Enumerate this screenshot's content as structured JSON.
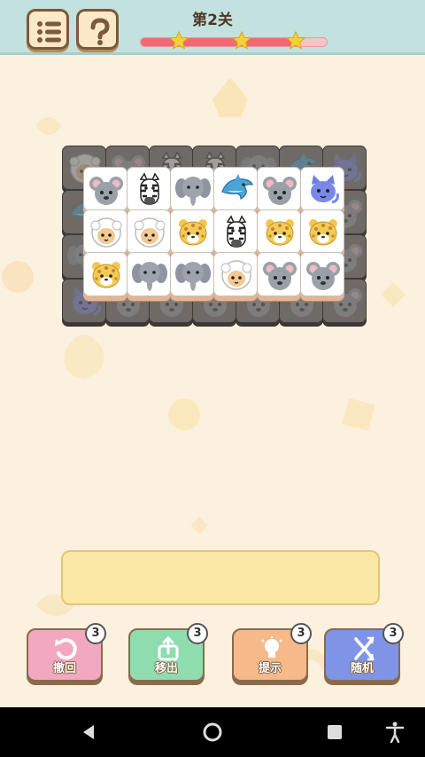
{
  "header": {
    "level_title": "第2关",
    "progress": 0.85,
    "stars_earned": 3
  },
  "board": {
    "lower_layer": [
      [
        "sheep",
        "mouse",
        "zebra",
        "zebra",
        "elephant",
        "dolphin",
        "cat"
      ],
      [
        "dolphin",
        "",
        "",
        "",
        "",
        "",
        ""
      ],
      [
        "elephant",
        "",
        "",
        "",
        "",
        "",
        "mouse"
      ],
      [
        "cat",
        "",
        "",
        "",
        "",
        "",
        ""
      ]
    ],
    "upper_layer": [
      [
        "mouse",
        "zebra",
        "elephant",
        "dolphin",
        "mouse",
        "cat"
      ],
      [
        "sheep",
        "sheep",
        "leopard",
        "zebra",
        "leopard",
        "leopard"
      ],
      [
        "leopard",
        "elephant",
        "elephant",
        "sheep",
        "mouse",
        "mouse"
      ]
    ]
  },
  "tray": {
    "slots": 7,
    "tiles": []
  },
  "tools": [
    {
      "key": "undo",
      "label": "撤回",
      "count": "3",
      "color": "#f2a8c0",
      "icon": "undo-icon"
    },
    {
      "key": "remove",
      "label": "移出",
      "count": "3",
      "color": "#8fdcaf",
      "icon": "remove-out-icon"
    },
    {
      "key": "hint",
      "label": "提示",
      "count": "3",
      "color": "#f6b98a",
      "icon": "lightbulb-icon"
    },
    {
      "key": "shuffle",
      "label": "随机",
      "count": "3",
      "color": "#7f94e6",
      "icon": "shuffle-icon"
    }
  ],
  "colors": {
    "topbar": "#c3e1de",
    "background": "#fcf1de",
    "progress": "#ee6b76",
    "star": "#f6d03b"
  },
  "navbar": {
    "buttons": [
      "back-icon",
      "home-icon",
      "recents-icon",
      "accessibility-icon"
    ]
  }
}
